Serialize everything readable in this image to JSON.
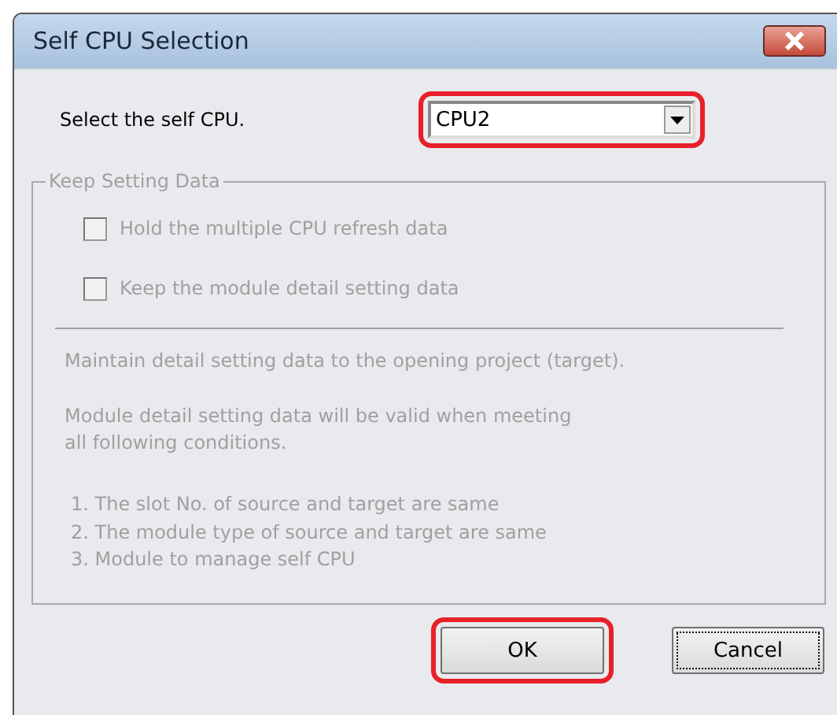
{
  "window": {
    "title": "Self CPU Selection"
  },
  "cpu_select": {
    "label": "Select the self CPU.",
    "value": "CPU2",
    "highlighted": true
  },
  "keep_setting_data": {
    "title": "Keep Setting Data",
    "disabled": true,
    "checkboxes": [
      {
        "label": "Hold the multiple CPU refresh data",
        "checked": false
      },
      {
        "label": "Keep the module detail setting data",
        "checked": false
      }
    ],
    "notes": [
      "Maintain detail setting data to the opening project (target).",
      "Module detail setting data will be valid when meeting\nall following conditions."
    ],
    "conditions": [
      "1. The slot No. of source and target are same",
      "2. The module type of source and target are same",
      "3. Module to manage self CPU"
    ]
  },
  "buttons": [
    {
      "label": "OK",
      "highlighted": true,
      "focused": false
    },
    {
      "label": "Cancel",
      "highlighted": false,
      "focused": true
    }
  ]
}
